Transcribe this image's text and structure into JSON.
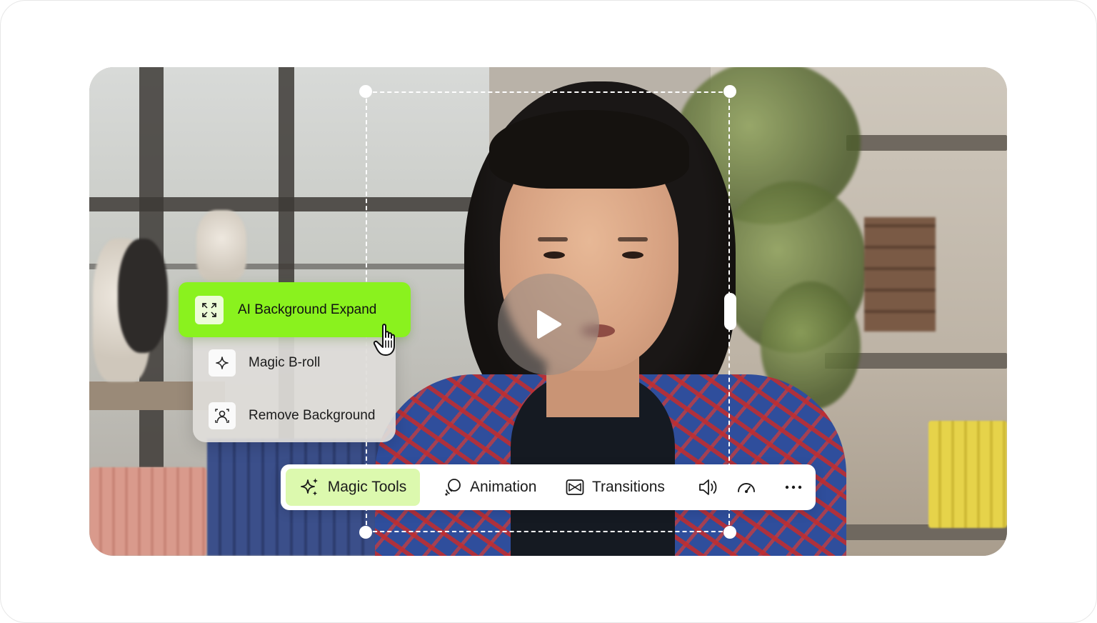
{
  "menu": {
    "highlighted": {
      "label": "AI Background Expand",
      "icon": "expand-icon"
    },
    "items": [
      {
        "label": "Magic B-roll",
        "icon": "sparkle-icon"
      },
      {
        "label": "Remove Background",
        "icon": "person-cutout-icon"
      }
    ]
  },
  "toolbar": {
    "magic_tools": {
      "label": "Magic Tools",
      "icon": "sparkles-icon"
    },
    "animation": {
      "label": "Animation",
      "icon": "animation-icon"
    },
    "transitions": {
      "label": "Transitions",
      "icon": "transitions-icon"
    },
    "volume": {
      "icon": "volume-icon"
    },
    "speed": {
      "icon": "speed-gauge-icon"
    },
    "more": {
      "icon": "more-icon"
    }
  },
  "colors": {
    "accent_green": "#8af21e",
    "active_tab_bg": "#dcf9ae",
    "toolbar_bg": "#ffffff"
  }
}
